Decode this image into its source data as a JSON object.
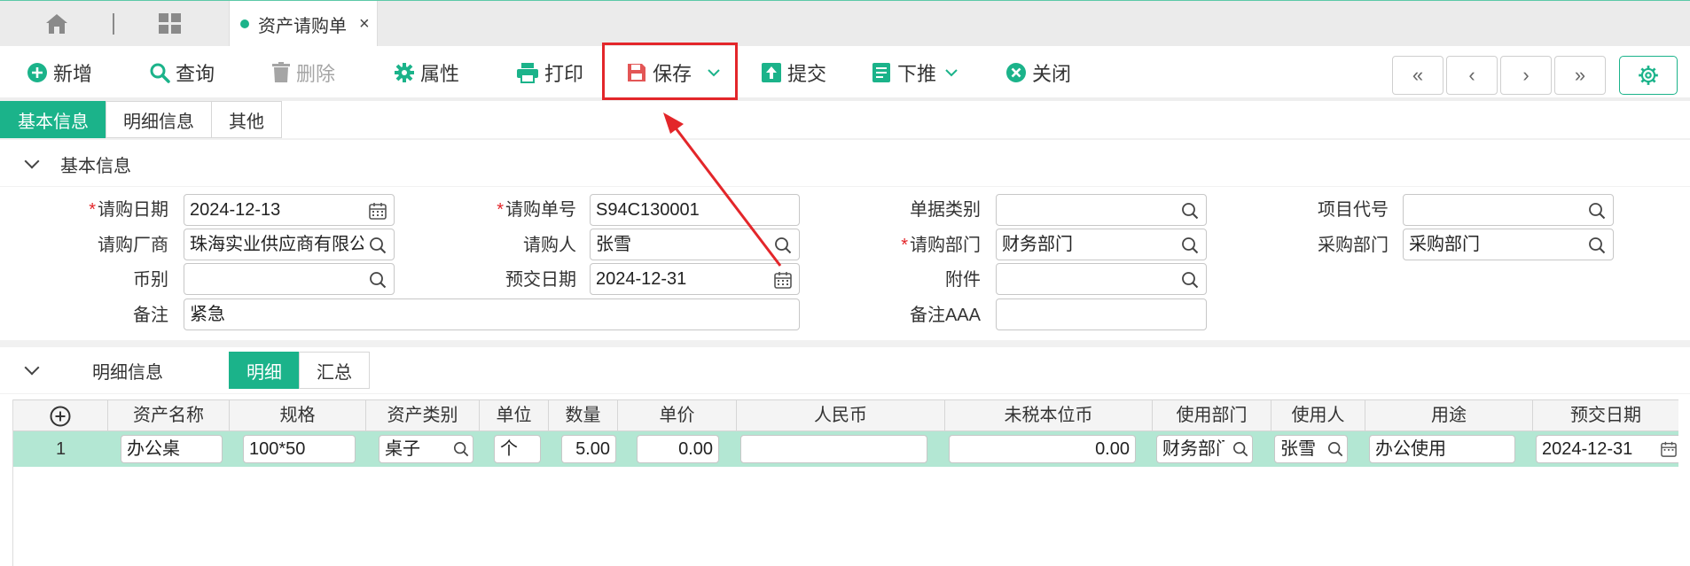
{
  "tab": {
    "title": "资产请购单",
    "close": "×"
  },
  "toolbar": {
    "add": "新增",
    "query": "查询",
    "delete": "删除",
    "properties": "属性",
    "print": "打印",
    "save": "保存",
    "submit": "提交",
    "push_down": "下推",
    "close": "关闭"
  },
  "nav": {
    "first": "«",
    "prev": "‹",
    "next": "›",
    "last": "»"
  },
  "section_tabs": [
    "基本信息",
    "明细信息",
    "其他"
  ],
  "basic": {
    "header": "基本信息",
    "labels": {
      "request_date": "请购日期",
      "request_no": "请购单号",
      "doc_type": "单据类别",
      "project_code": "项目代号",
      "vendor": "请购厂商",
      "requester": "请购人",
      "request_dept": "请购部门",
      "purchase_dept": "采购部门",
      "currency": "币别",
      "expected_date": "预交日期",
      "attachment": "附件",
      "remark": "备注",
      "remark_aaa": "备注AAA"
    },
    "values": {
      "request_date": "2024-12-13",
      "request_no": "S94C130001",
      "doc_type": "",
      "project_code": "",
      "vendor": "珠海实业供应商有限公司",
      "requester": "张雪",
      "request_dept": "财务部门",
      "purchase_dept": "采购部门",
      "currency": "",
      "expected_date": "2024-12-31",
      "attachment": "",
      "remark": "紧急",
      "remark_aaa": ""
    },
    "required_mark": "*"
  },
  "detail": {
    "header": "明细信息",
    "subtabs": [
      "明细",
      "汇总"
    ],
    "columns": [
      "资产名称",
      "规格",
      "资产类别",
      "单位",
      "数量",
      "单价",
      "人民币",
      "未税本位币",
      "使用部门",
      "使用人",
      "用途",
      "预交日期"
    ],
    "rows": [
      {
        "no": "1",
        "asset_name": "办公桌",
        "spec": "100*50",
        "category": "桌子",
        "unit": "个",
        "qty": "5.00",
        "price": "0.00",
        "rmb": "",
        "untaxed": "0.00",
        "dept": "财务部门",
        "user": "张雪",
        "purpose": "办公使用",
        "date": "2024-12-31"
      }
    ]
  },
  "colors": {
    "accent": "#1bb38a",
    "highlight_row": "#b3e7d3",
    "annotation": "#e3262a"
  }
}
